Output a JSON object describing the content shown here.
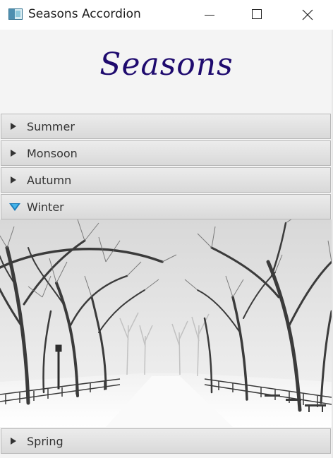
{
  "window": {
    "title": "Seasons Accordion"
  },
  "header": {
    "heading": "Seasons"
  },
  "accordion": {
    "panes": [
      {
        "label": "Summer",
        "expanded": false
      },
      {
        "label": "Monsoon",
        "expanded": false
      },
      {
        "label": "Autumn",
        "expanded": false
      },
      {
        "label": "Winter",
        "expanded": true
      },
      {
        "label": "Spring",
        "expanded": false
      }
    ]
  },
  "icons": {
    "app": "app-icon",
    "minimize": "minimize-icon",
    "maximize": "maximize-icon",
    "close": "close-icon",
    "collapsed": "chevron-right-icon",
    "expanded": "chevron-down-icon"
  },
  "colors": {
    "heading": "#1e0a6e",
    "expanded_arrow": "#43b4ea"
  }
}
